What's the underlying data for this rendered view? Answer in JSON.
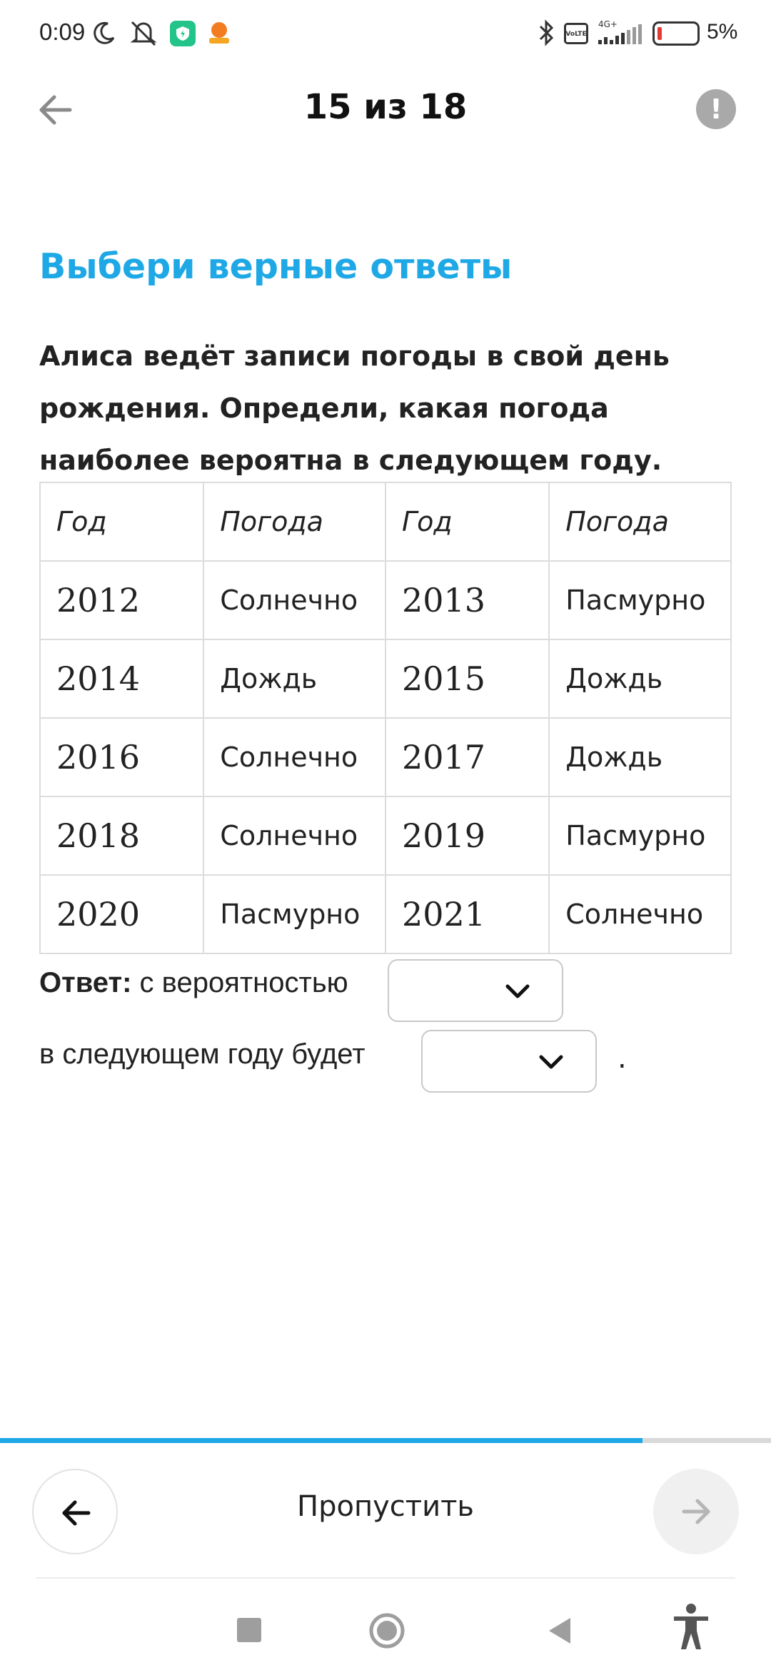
{
  "status_bar": {
    "time": "0:09",
    "network_label": "4G+",
    "volte_top": "Vo",
    "volte_bottom": "LTE",
    "battery_percent": "5%",
    "icons": [
      "moon-icon",
      "mute-icon",
      "shield-app-icon",
      "avatar-app-icon",
      "bluetooth-icon",
      "volte-icon",
      "signal-icon",
      "battery-icon"
    ]
  },
  "header": {
    "counter": "15 из 18",
    "back_icon": "arrow-left-icon",
    "report_label": "!"
  },
  "task": {
    "title": "Выбери верные ответы",
    "question": "Алиса ведёт записи погоды в свой день рождения. Определи, какая погода наиболее вероятна в следующем году."
  },
  "table": {
    "headers": [
      "Год",
      "Погода",
      "Год",
      "Погода"
    ],
    "rows": [
      [
        "2012",
        "Солнечно",
        "2013",
        "Пасмурно"
      ],
      [
        "2014",
        "Дождь",
        "2015",
        "Дождь"
      ],
      [
        "2016",
        "Солнечно",
        "2017",
        "Дождь"
      ],
      [
        "2018",
        "Солнечно",
        "2019",
        "Пасмурно"
      ],
      [
        "2020",
        "Пасмурно",
        "2021",
        "Солнечно"
      ]
    ]
  },
  "answer": {
    "label": "Ответ:",
    "text_1": "с вероятностью",
    "text_2": "в следующем году будет",
    "period": ".",
    "select_1_value": "",
    "select_2_value": ""
  },
  "progress": {
    "current": 15,
    "total": 18,
    "fraction": 0.833
  },
  "footer": {
    "skip_label": "Пропустить"
  },
  "colors": {
    "accent": "#1ea8e5",
    "report_gray": "#a9a9a9"
  }
}
